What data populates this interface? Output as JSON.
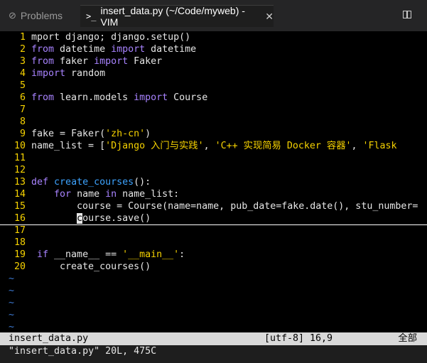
{
  "tabs": {
    "problems_label": "Problems",
    "vim_label": "insert_data.py (~/Code/myweb) - VIM",
    "term_glyph": ">_"
  },
  "editor": {
    "lines": [
      {
        "n": "1",
        "text": "mport django; django.setup()"
      },
      {
        "n": "2",
        "text": "from datetime import datetime"
      },
      {
        "n": "3",
        "text": "from faker import Faker"
      },
      {
        "n": "4",
        "text": "import random"
      },
      {
        "n": "5",
        "text": ""
      },
      {
        "n": "6",
        "text": "from learn.models import Course"
      },
      {
        "n": "7",
        "text": ""
      },
      {
        "n": "8",
        "text": ""
      },
      {
        "n": "9",
        "text": "fake = Faker('zh-cn')"
      },
      {
        "n": "10",
        "text": "name_list = ['Django 入门与实践', 'C++ 实现简易 Docker 容器', 'Flask"
      },
      {
        "n": "11",
        "text": ""
      },
      {
        "n": "12",
        "text": ""
      },
      {
        "n": "13",
        "text": "def create_courses():"
      },
      {
        "n": "14",
        "text": "    for name in name_list:"
      },
      {
        "n": "15",
        "text": "        course = Course(name=name, pub_date=fake.date(), stu_number="
      },
      {
        "n": "16",
        "text": "        course.save()"
      },
      {
        "n": "17",
        "text": ""
      },
      {
        "n": "18",
        "text": ""
      },
      {
        "n": "19",
        "text": " if __name__ == '__main__':"
      },
      {
        "n": "20",
        "text": "     create_courses()"
      }
    ],
    "tilde": "~"
  },
  "status": {
    "filename": "insert_data.py",
    "encoding_pos": "[utf-8] 16,9",
    "all": "全部"
  },
  "cmdline": "\"insert_data.py\" 20L, 475C",
  "colors": {
    "line_numbers": "#f6d200",
    "keyword": "#a883ff",
    "function": "#3da3ff",
    "string": "#f6d200",
    "tilde": "#3d7bd6"
  }
}
